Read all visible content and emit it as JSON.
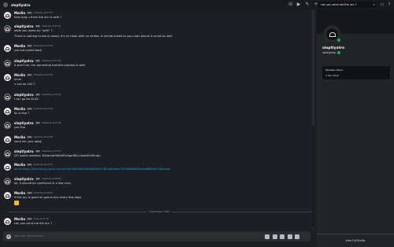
{
  "header": {
    "channel_title": "sleptlyatro",
    "search_value": "can you send me the acc ?"
  },
  "profile": {
    "display_name": "sleptlyatro",
    "username": "sleptlyatro",
    "member_since_label": "Member Since",
    "member_since_value": "4 Feb 2019",
    "footer_link": "View Full Profile"
  },
  "messages": [
    {
      "author": "Merlin",
      "tag": "GM",
      "time": "Yesterday at 07:55",
      "lines": [
        "how long u think the acc is safe ?"
      ]
    },
    {
      "author": "sleptlyatro",
      "tag": "GM",
      "time": "Yesterday at 07:55",
      "lines": [
        "what you mean by \"safe\" ?",
        "There is nothing to worry about, it's all clean with no strikes. It will be linked to your own phone & email as well"
      ]
    },
    {
      "author": "Merlin",
      "tag": "GM",
      "time": "Yesterday at 07:56",
      "lines": [
        "yes but pulled back"
      ]
    },
    {
      "author": "sleptlyatro",
      "tag": "GM",
      "time": "Yesterday at 07:56",
      "lines": [
        "it won't be, the ownership transfer process is safe"
      ]
    },
    {
      "author": "Merlin",
      "tag": "GM",
      "time": "Yesterday at 07:56",
      "lines": [
        "hmm",
        "u can do 100 ?"
      ]
    },
    {
      "author": "sleptlyatro",
      "tag": "GM",
      "time": "Yesterday at 07:56",
      "lines": [
        "I can go for $140"
      ]
    },
    {
      "author": "Merlin",
      "tag": "GM",
      "time": "Yesterday at 07:56",
      "lines": [
        "ltc is fine ?"
      ]
    },
    {
      "author": "sleptlyatro",
      "tag": "GM",
      "time": "Yesterday at 07:56",
      "lines": [
        "yes fine"
      ]
    },
    {
      "author": "Merlin",
      "tag": "GM",
      "time": "Yesterday at 07:56",
      "lines": [
        "send me your addy"
      ]
    },
    {
      "author": "sleptlyatro",
      "tag": "GM",
      "time": "Yesterday at 07:57",
      "lines": [
        "LTC wallet address: MQwmdHkBdHFkdapUBLLnAdeKGrMnrqu"
      ]
    },
    {
      "author": "Merlin",
      "tag": "GM",
      "time": "Yesterday at 07:59",
      "lines": [
        "done https://live.blockcypher.com/ltc/tx/7bf20bf4f9b8e65bb47f82af83ddef752f9d8bbf62a6ad8850e794ecbd4"
      ]
    },
    {
      "author": "sleptlyatro",
      "tag": "GM",
      "time": "Yesterday at 08:00",
      "lines": [
        "ok, it should be confirmed in a few mins"
      ]
    },
    {
      "author": "Merlin",
      "tag": "GM",
      "time": "Yesterday at 08:05",
      "lines": [
        "if the acc is good im gonna buy every few days"
      ]
    },
    {
      "author": "Merlin",
      "tag": "GM",
      "time": "Today at 07:10",
      "lines": [
        "can you send me the acc ?"
      ]
    }
  ],
  "date_divider": "5 September 2024",
  "composer": {
    "placeholder": "Message @sleptlyatro"
  }
}
